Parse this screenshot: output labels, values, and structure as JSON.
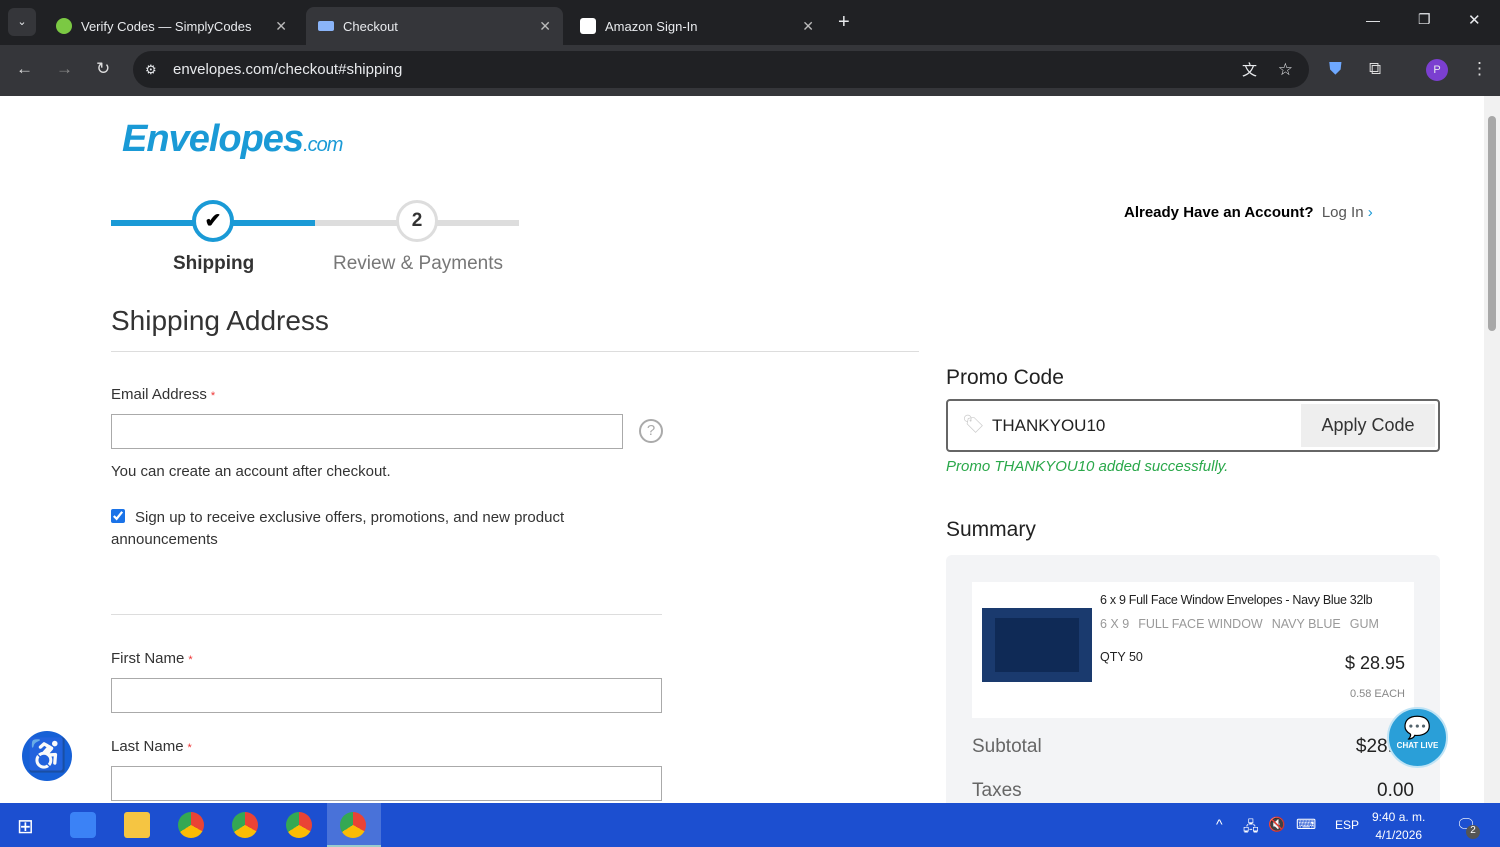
{
  "browser": {
    "tabs": [
      {
        "title": "Verify Codes — SimplyCodes"
      },
      {
        "title": "Checkout"
      },
      {
        "title": "Amazon Sign-In"
      }
    ],
    "url": "envelopes.com/checkout#shipping"
  },
  "header": {
    "logo": "Envelopes.com",
    "logo_main": "Envelopes",
    "logo_suffix": ".com",
    "account_prompt": "Already Have an Account?",
    "login": "Log In"
  },
  "steps": [
    {
      "label": "Shipping",
      "num": "✔"
    },
    {
      "label": "Review & Payments",
      "num": "2"
    }
  ],
  "form": {
    "title": "Shipping Address",
    "email_label": "Email Address",
    "req": "*",
    "email_value": "",
    "email_hint": "You can create an account after checkout.",
    "newsletter": "Sign up to receive exclusive offers, promotions, and new product announcements",
    "newsletter_checked": true,
    "first_name": "First Name",
    "last_name": "Last Name"
  },
  "promo": {
    "title": "Promo Code",
    "value": "THANKYOU10",
    "apply": "Apply Code",
    "message": "Promo THANKYOU10 added successfully."
  },
  "summary": {
    "title": "Summary",
    "item": {
      "name": "6 x 9 Full Face Window Envelopes - Navy Blue 32lb",
      "attrs": [
        "6 X 9",
        "FULL FACE WINDOW",
        "NAVY BLUE",
        "GUM"
      ],
      "qty": "QTY 50",
      "price": "$ 28.95",
      "each": "0.58 EACH"
    },
    "subtotal_label": "Subtotal",
    "subtotal": "$28.95",
    "taxes_label": "Taxes",
    "taxes": "0.00"
  },
  "chat": {
    "label": "CHAT LIVE"
  },
  "taskbar": {
    "lang": "ESP",
    "time": "9:40 a. m.",
    "date": "4/1/2026",
    "notifications": "2"
  },
  "colors": {
    "accent": "#1a9ad6",
    "success": "#2aa84a",
    "taskbar": "#1c4fd0"
  }
}
